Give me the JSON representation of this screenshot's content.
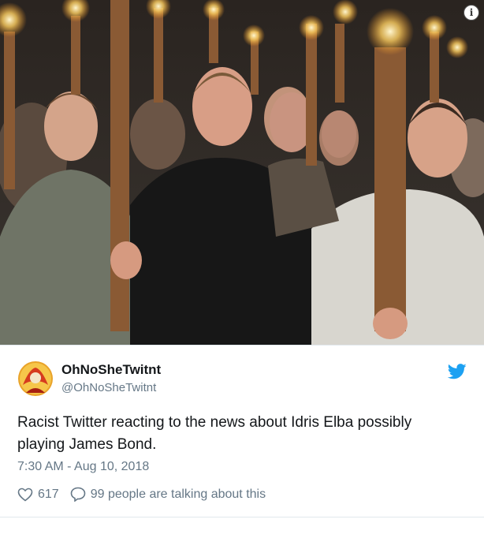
{
  "tweet": {
    "display_name": "OhNoSheTwitnt",
    "handle": "@OhNoSheTwitnt",
    "text": "Racist Twitter reacting to the news about Idris Elba possibly playing James Bond.",
    "timestamp": "7:30 AM - Aug 10, 2018",
    "likes": "617",
    "replies_label": "99 people are talking about this"
  },
  "icons": {
    "info": "info-icon",
    "bird": "twitter-bird-icon",
    "heart": "heart-icon",
    "reply": "speech-bubble-icon"
  },
  "colors": {
    "twitter_blue": "#1da1f2",
    "secondary_text": "#657786",
    "primary_text": "#14171a"
  },
  "info_glyph": "i"
}
